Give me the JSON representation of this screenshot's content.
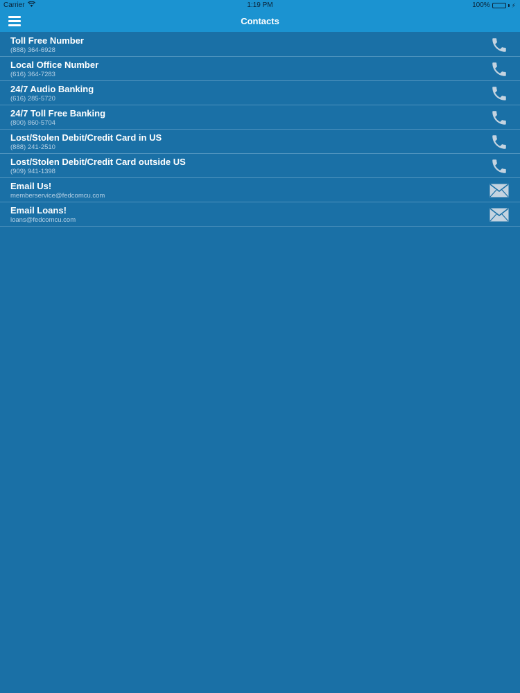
{
  "status_bar": {
    "carrier": "Carrier",
    "time": "1:19 PM",
    "battery": "100%"
  },
  "nav": {
    "title": "Contacts",
    "menu_icon": "hamburger-menu-icon"
  },
  "colors": {
    "background": "#1a70a6",
    "nav_bar": "#1b93d1",
    "detail_text": "#b8d2e6",
    "icon": "#c4d3e0"
  },
  "contacts": [
    {
      "title": "Toll Free Number",
      "detail": "(888) 364-6928",
      "icon": "phone-icon"
    },
    {
      "title": "Local Office Number",
      "detail": "(616) 364-7283",
      "icon": "phone-icon"
    },
    {
      "title": "24/7 Audio Banking",
      "detail": "(616) 285-5720",
      "icon": "phone-icon"
    },
    {
      "title": "24/7 Toll Free Banking",
      "detail": "(800) 860-5704",
      "icon": "phone-icon"
    },
    {
      "title": "Lost/Stolen Debit/Credit Card in US",
      "detail": "(888) 241-2510",
      "icon": "phone-icon"
    },
    {
      "title": "Lost/Stolen Debit/Credit Card outside US",
      "detail": "(909) 941-1398",
      "icon": "phone-icon"
    },
    {
      "title": "Email Us!",
      "detail": "memberservice@fedcomcu.com",
      "icon": "mail-icon"
    },
    {
      "title": "Email Loans!",
      "detail": "loans@fedcomcu.com",
      "icon": "mail-icon"
    }
  ]
}
